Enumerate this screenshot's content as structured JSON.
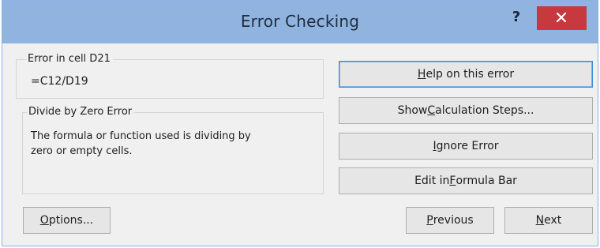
{
  "window": {
    "title": "Error Checking",
    "help_glyph": "?",
    "close_icon": "close-icon",
    "colors": {
      "titlebar": "#90b3e0",
      "close": "#c7383f"
    }
  },
  "error_cell": {
    "label": "Error in cell D21",
    "formula": "=C12/D19"
  },
  "error_type": {
    "label": "Divide by Zero Error",
    "description_line1": "The formula or function used is dividing by",
    "description_line2": "zero or empty cells."
  },
  "buttons": {
    "help": {
      "pre": "",
      "key": "H",
      "post": "elp on this error"
    },
    "steps": {
      "pre": "Show ",
      "key": "C",
      "post": "alculation Steps..."
    },
    "ignore": {
      "pre": "",
      "key": "I",
      "post": "gnore Error"
    },
    "edit": {
      "pre": "Edit in ",
      "key": "F",
      "post": "ormula Bar"
    },
    "options": {
      "pre": "",
      "key": "O",
      "post": "ptions..."
    },
    "previous": {
      "pre": "",
      "key": "P",
      "post": "revious"
    },
    "next": {
      "pre": "",
      "key": "N",
      "post": "ext"
    }
  }
}
